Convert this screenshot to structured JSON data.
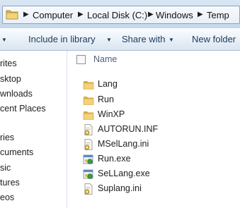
{
  "address_bar": {
    "breadcrumbs": [
      "Computer",
      "Local Disk (C:)",
      "Windows",
      "Temp"
    ]
  },
  "toolbar": {
    "include_label": "Include in library",
    "share_label": "Share with",
    "new_folder_label": "New folder"
  },
  "nav_pane": {
    "items": [
      "rites",
      "sktop",
      "wnloads",
      "cent Places",
      "ries",
      "cuments",
      "sic",
      "tures",
      "eos"
    ]
  },
  "content": {
    "header": {
      "name_label": "Name"
    },
    "files": [
      {
        "name": "Lang",
        "icon": "folder-icon"
      },
      {
        "name": "Run",
        "icon": "folder-icon"
      },
      {
        "name": "WinXP",
        "icon": "folder-icon"
      },
      {
        "name": "AUTORUN.INF",
        "icon": "settings-file-icon"
      },
      {
        "name": "MSelLang.ini",
        "icon": "settings-file-icon"
      },
      {
        "name": "Run.exe",
        "icon": "exe-icon"
      },
      {
        "name": "SeLLang.exe",
        "icon": "exe-icon"
      },
      {
        "name": "Suplang.ini",
        "icon": "settings-file-icon"
      }
    ]
  },
  "colors": {
    "toolbar_text": "#1c3a5a",
    "folder_yellow": "#e8c35a",
    "header_text": "#4c607a"
  }
}
